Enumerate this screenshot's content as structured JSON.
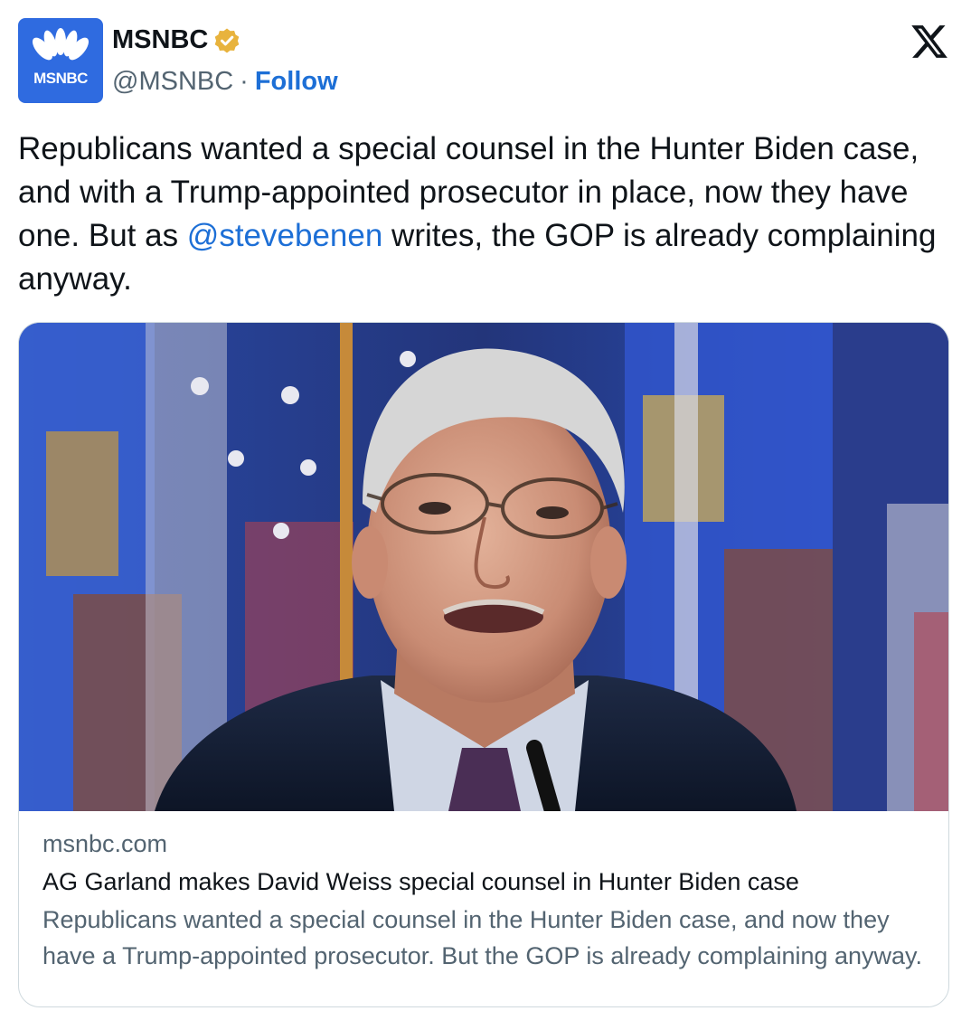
{
  "account": {
    "name": "MSNBC",
    "handle": "@MSNBC",
    "separator": "·",
    "follow_label": "Follow",
    "avatar_text": "MSNBC",
    "verified": true,
    "verified_badge_color": "#e8b33d",
    "avatar_color": "#2f6be0"
  },
  "platform_icon": "x-logo-icon",
  "tweet": {
    "text_before_mention": "Republicans wanted a special counsel in the Hunter Biden case, and with a Trump-appointed prosecutor in place, now they have one. But as ",
    "mention": "@stevebenen",
    "text_after_mention": " writes, the GOP is already complaining anyway."
  },
  "link_card": {
    "domain": "msnbc.com",
    "title": "AG Garland makes David Weiss special counsel in Hunter Biden case",
    "description": "Republicans wanted a special counsel in the Hunter Biden case, and now they have a Trump-appointed prosecutor. But the GOP is already complaining anyway."
  },
  "colors": {
    "link": "#1d6fd6",
    "text": "#0f1419",
    "muted": "#536471",
    "border": "#cfd9de"
  }
}
